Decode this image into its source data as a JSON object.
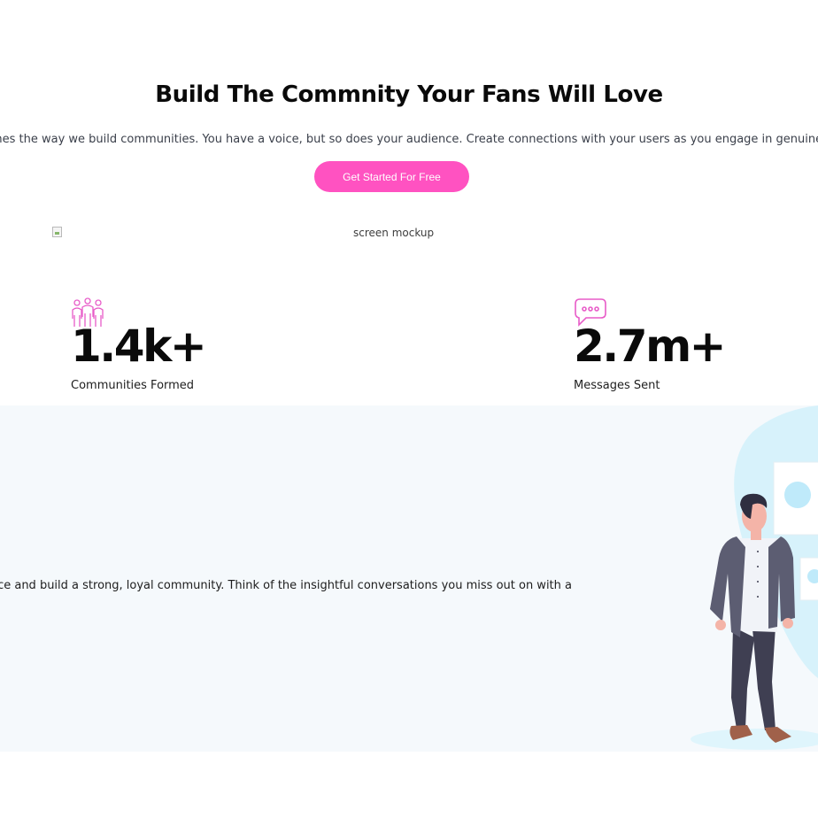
{
  "hero": {
    "title": "Build The Commnity Your Fans Will Love",
    "subtitle": "gines the way we build communities. You have a voice, but so does your audience. Create connections with your users as you engage in genuine d",
    "cta_label": "Get Started For Free"
  },
  "mockup": {
    "alt_text": "screen mockup"
  },
  "stats": [
    {
      "icon": "community-icon",
      "value": "1.4k+",
      "label": "Communities Formed"
    },
    {
      "icon": "chat-bubble-icon",
      "value": "2.7m+",
      "label": "Messages Sent"
    }
  ],
  "lower": {
    "text": "dience and build a strong, loyal community. Think of the insightful conversations you miss out on with a"
  },
  "colors": {
    "accent": "#ff52c1",
    "icon_accent": "#e85cc8",
    "lower_background": "#f5f9fc",
    "illustration_blob": "#d7f2fb"
  }
}
